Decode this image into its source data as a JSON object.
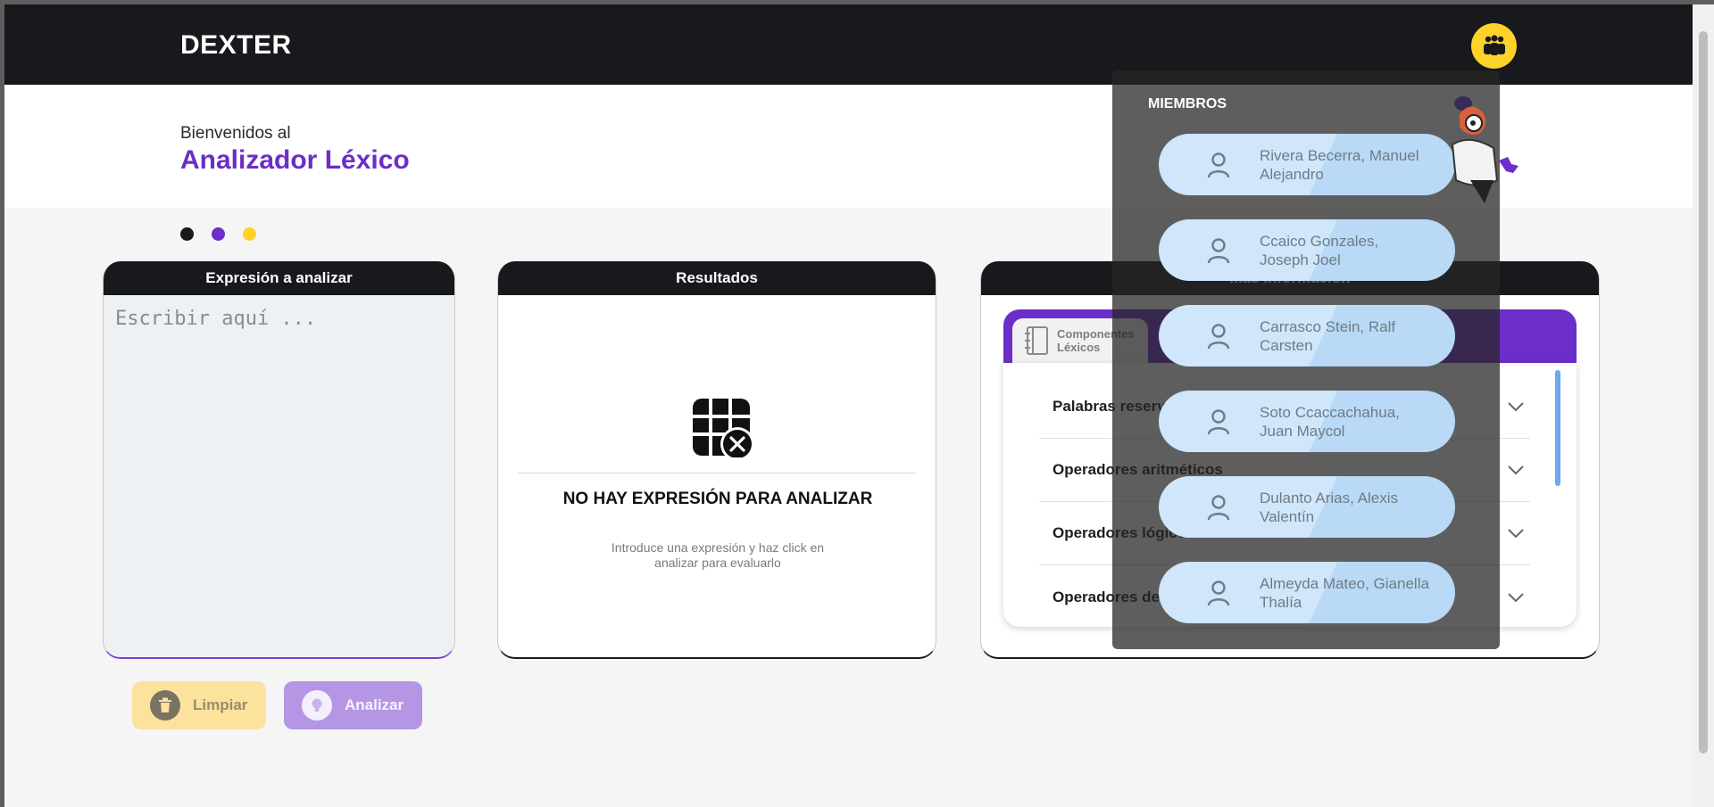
{
  "header": {
    "brand": "DEXTER",
    "team_icon": "group-icon"
  },
  "hero": {
    "subtitle": "Bienvenidos al",
    "title": "Analizador Léxico"
  },
  "colors": {
    "dark": "#17191c",
    "purple": "#6c2ec8",
    "yellow": "#ffd22a"
  },
  "expression": {
    "title": "Expresión a analizar",
    "placeholder": "Escribir aquí ...",
    "value": ""
  },
  "results": {
    "title": "Resultados",
    "empty_title": "NO HAY EXPRESIÓN PARA ANALIZAR",
    "empty_desc": "Introduce una expresión y haz click en analizar para evaluarlo"
  },
  "info": {
    "title": "Más Información",
    "tab_label": "Componentes Léxicos",
    "items": [
      {
        "label": "Palabras reservadas"
      },
      {
        "label": "Operadores aritméticos"
      },
      {
        "label": "Operadores lógicos"
      },
      {
        "label": "Operadores de"
      }
    ]
  },
  "actions": {
    "clear_label": "Limpiar",
    "analyze_label": "Analizar"
  },
  "members": {
    "title": "MIEMBROS",
    "list": [
      {
        "name": "Rivera Becerra, Manuel Alejandro"
      },
      {
        "name": "Ccaico Gonzales, Joseph Joel"
      },
      {
        "name": "Carrasco Stein, Ralf Carsten"
      },
      {
        "name": "Soto Ccaccachahua, Juan Maycol"
      },
      {
        "name": "Dulanto Arias, Alexis Valentín"
      },
      {
        "name": "Almeyda Mateo, Gianella Thalía"
      }
    ]
  }
}
